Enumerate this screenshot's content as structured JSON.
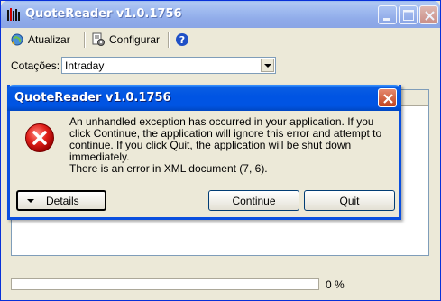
{
  "main_window": {
    "title": "QuoteReader v1.0.1756",
    "toolbar": {
      "update_label": "Atualizar",
      "configure_label": "Configurar"
    },
    "quotes": {
      "label": "Cotações:",
      "selected": "Intraday"
    },
    "progress": {
      "value_percent": 0,
      "label": "0 %"
    }
  },
  "dialog": {
    "title": "QuoteReader v1.0.1756",
    "message": "An unhandled exception has occurred in your application. If you click Continue, the application will ignore this error and attempt to continue. If you click Quit, the application will be shut down immediately.",
    "detail": "There is an error in XML document (7, 6).",
    "details_label": "Details",
    "continue_label": "Continue",
    "quit_label": "Quit"
  },
  "icons": {
    "app": "bar-chart-icon",
    "update": "refresh-globe-icon",
    "configure": "settings-document-icon",
    "help": "help-icon",
    "error": "error-icon"
  }
}
